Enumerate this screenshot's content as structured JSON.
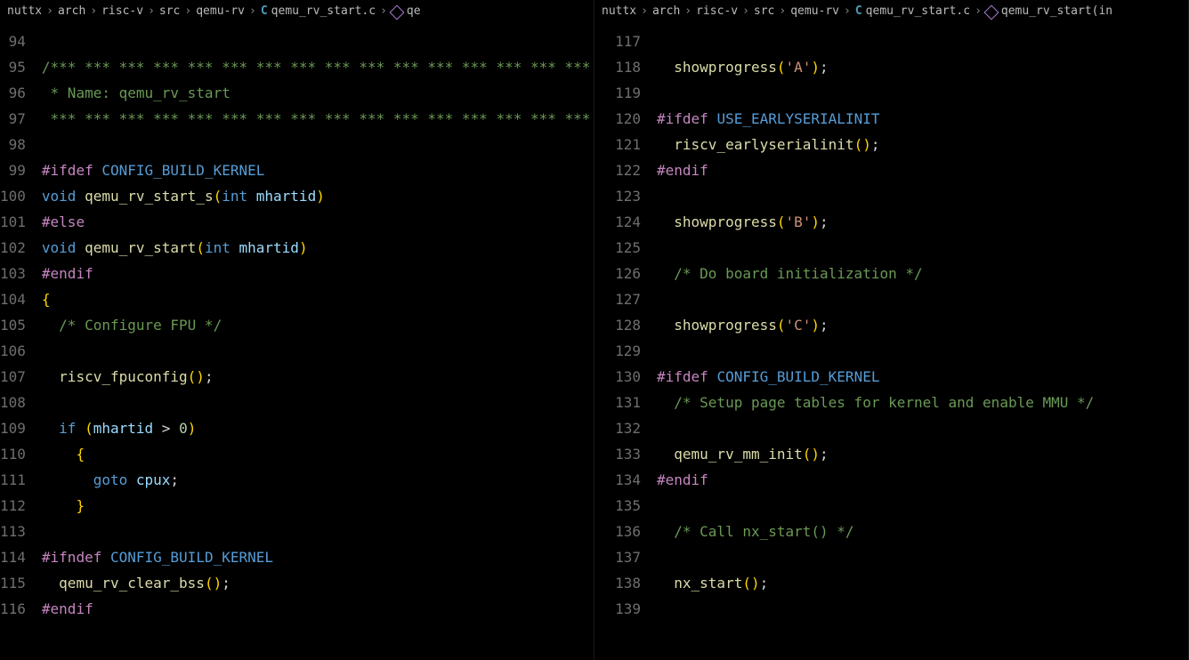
{
  "pane1": {
    "breadcrumb": [
      "nuttx",
      "arch",
      "risc-v",
      "src",
      "qemu-rv",
      "qemu_rv_start.c",
      "qe"
    ],
    "fileLang": "C",
    "lineStart": 94,
    "lines": [
      {
        "n": 94,
        "t": ""
      },
      {
        "n": 95,
        "t": "comment",
        "text": "/*** *** *** *** *** *** *** *** *** *** *** *** *** *** *** *** **"
      },
      {
        "n": 96,
        "t": "comment",
        "text": " * Name: qemu_rv_start"
      },
      {
        "n": 97,
        "t": "comment",
        "text": " *** *** *** *** *** *** *** *** *** *** *** *** *** *** *** *** **"
      },
      {
        "n": 98,
        "t": ""
      },
      {
        "n": 99,
        "t": "pp",
        "pp": "#ifdef",
        "sym": "CONFIG_BUILD_KERNEL"
      },
      {
        "n": 100,
        "t": "sig",
        "ret": "void",
        "name": "qemu_rv_start_s",
        "ptype": "int",
        "pname": "mhartid"
      },
      {
        "n": 101,
        "t": "pp",
        "pp": "#else"
      },
      {
        "n": 102,
        "t": "sig",
        "ret": "void",
        "name": "qemu_rv_start",
        "ptype": "int",
        "pname": "mhartid"
      },
      {
        "n": 103,
        "t": "pp",
        "pp": "#endif"
      },
      {
        "n": 104,
        "t": "brace",
        "text": "{"
      },
      {
        "n": 105,
        "t": "comment",
        "text": "  /* Configure FPU */"
      },
      {
        "n": 106,
        "t": ""
      },
      {
        "n": 107,
        "t": "call",
        "name": "riscv_fpuconfig",
        "args": ""
      },
      {
        "n": 108,
        "t": ""
      },
      {
        "n": 109,
        "t": "if",
        "cond": "mhartid > 0"
      },
      {
        "n": 110,
        "t": "braceI",
        "text": "    {"
      },
      {
        "n": 111,
        "t": "goto",
        "label": "cpux"
      },
      {
        "n": 112,
        "t": "braceI",
        "text": "    }"
      },
      {
        "n": 113,
        "t": ""
      },
      {
        "n": 114,
        "t": "pp",
        "pp": "#ifndef",
        "sym": "CONFIG_BUILD_KERNEL"
      },
      {
        "n": 115,
        "t": "call",
        "name": "qemu_rv_clear_bss",
        "args": ""
      },
      {
        "n": 116,
        "t": "pp",
        "pp": "#endif"
      }
    ]
  },
  "pane2": {
    "breadcrumb": [
      "nuttx",
      "arch",
      "risc-v",
      "src",
      "qemu-rv",
      "qemu_rv_start.c",
      "qemu_rv_start(in"
    ],
    "fileLang": "C",
    "lineStart": 117,
    "lines": [
      {
        "n": 117,
        "t": ""
      },
      {
        "n": 118,
        "t": "callS",
        "name": "showprogress",
        "arg": "'A'"
      },
      {
        "n": 119,
        "t": ""
      },
      {
        "n": 120,
        "t": "pp",
        "pp": "#ifdef",
        "sym": "USE_EARLYSERIALINIT"
      },
      {
        "n": 121,
        "t": "call",
        "name": "riscv_earlyserialinit",
        "args": ""
      },
      {
        "n": 122,
        "t": "pp",
        "pp": "#endif"
      },
      {
        "n": 123,
        "t": ""
      },
      {
        "n": 124,
        "t": "callS",
        "name": "showprogress",
        "arg": "'B'"
      },
      {
        "n": 125,
        "t": ""
      },
      {
        "n": 126,
        "t": "comment",
        "text": "  /* Do board initialization */"
      },
      {
        "n": 127,
        "t": ""
      },
      {
        "n": 128,
        "t": "callS",
        "name": "showprogress",
        "arg": "'C'"
      },
      {
        "n": 129,
        "t": ""
      },
      {
        "n": 130,
        "t": "pp",
        "pp": "#ifdef",
        "sym": "CONFIG_BUILD_KERNEL"
      },
      {
        "n": 131,
        "t": "comment",
        "text": "  /* Setup page tables for kernel and enable MMU */"
      },
      {
        "n": 132,
        "t": ""
      },
      {
        "n": 133,
        "t": "call",
        "name": "qemu_rv_mm_init",
        "args": ""
      },
      {
        "n": 134,
        "t": "pp",
        "pp": "#endif"
      },
      {
        "n": 135,
        "t": ""
      },
      {
        "n": 136,
        "t": "comment",
        "text": "  /* Call nx_start() */"
      },
      {
        "n": 137,
        "t": ""
      },
      {
        "n": 138,
        "t": "call",
        "name": "nx_start",
        "args": ""
      },
      {
        "n": 139,
        "t": ""
      }
    ]
  }
}
